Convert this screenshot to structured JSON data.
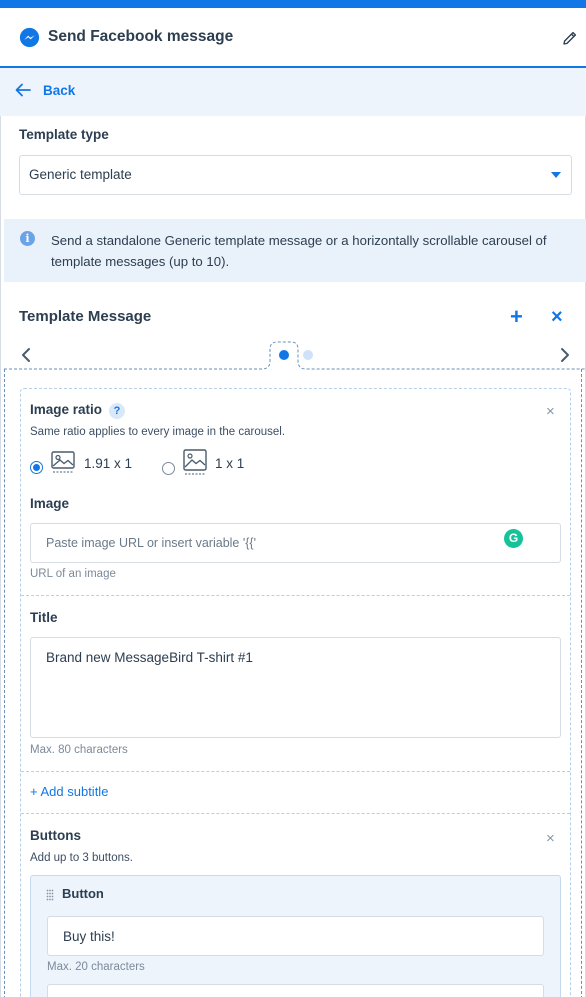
{
  "header": {
    "title": "Send Facebook message",
    "icon": "messenger-icon",
    "edit_icon": "pencil-icon"
  },
  "back": {
    "label": "Back"
  },
  "template_type": {
    "label": "Template type",
    "value": "Generic template"
  },
  "info": {
    "text": "Send a standalone Generic template message or a horizontally scrollable carousel of template messages (up to 10)."
  },
  "template_message": {
    "heading": "Template Message",
    "add": "+",
    "remove": "×",
    "pages": {
      "active": 1,
      "total": 2
    }
  },
  "image_ratio": {
    "label": "Image ratio",
    "help": "?",
    "description": "Same ratio applies to every image in the carousel.",
    "options": [
      {
        "label": "1.91 x 1",
        "selected": true
      },
      {
        "label": "1 x 1",
        "selected": false
      }
    ],
    "close": "×"
  },
  "image": {
    "label": "Image",
    "placeholder": "Paste image URL or insert variable '{{'",
    "hint": "URL of an image",
    "extension_icon": "G"
  },
  "title": {
    "label": "Title",
    "value": "Brand new MessageBird T-shirt #1",
    "hint": "Max. 80 characters"
  },
  "subtitle": {
    "add_label": "+ Add subtitle"
  },
  "buttons": {
    "label": "Buttons",
    "description": "Add up to 3 buttons.",
    "close": "×",
    "items": [
      {
        "heading": "Button",
        "value": "Buy this!",
        "hint": "Max. 20 characters"
      }
    ]
  },
  "colors": {
    "accent": "#1277e6",
    "info_bg": "#e9f1fb",
    "grammarly": "#15c39a"
  }
}
